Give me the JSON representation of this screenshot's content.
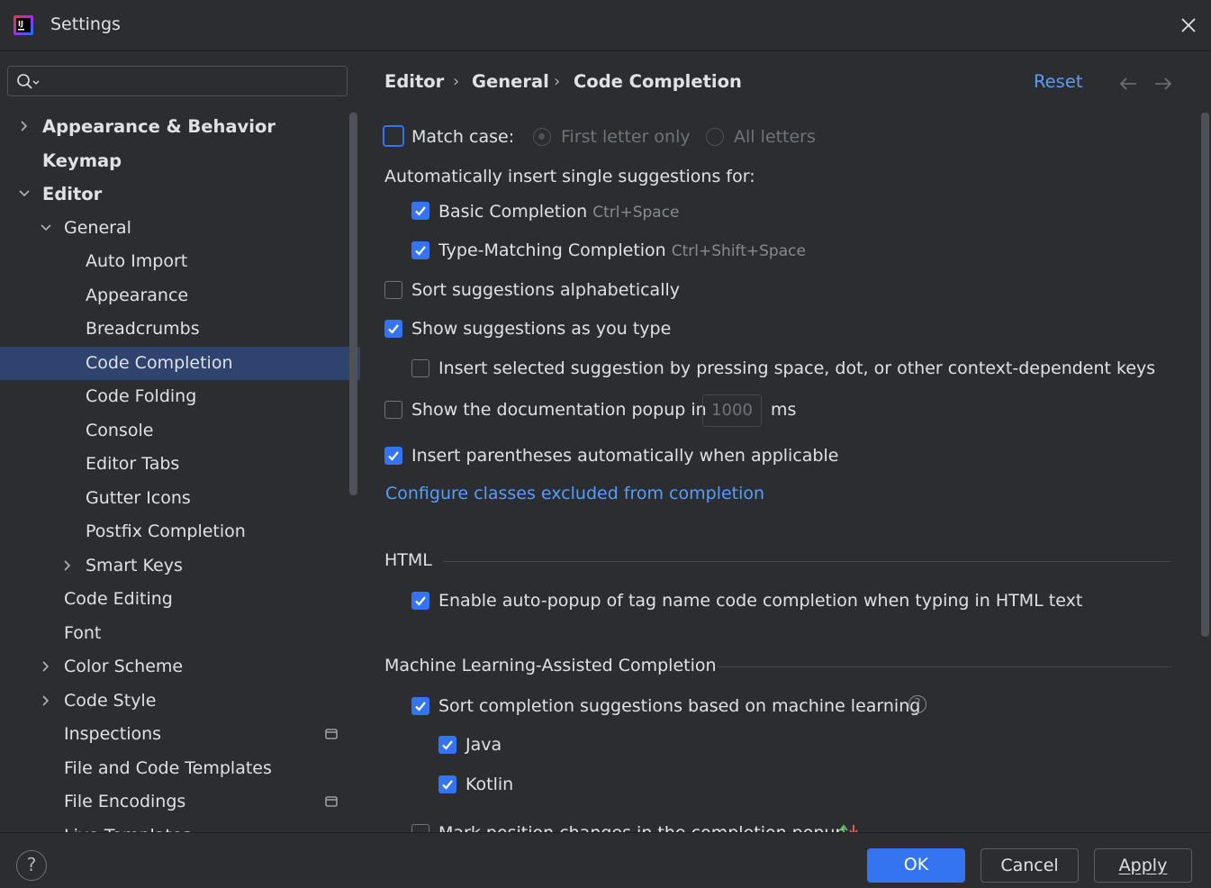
{
  "window": {
    "title": "Settings"
  },
  "search": {
    "placeholder": "",
    "value": ""
  },
  "tree": [
    {
      "label": "Appearance & Behavior",
      "level": 0,
      "bold": true,
      "arrow": "right"
    },
    {
      "label": "Keymap",
      "level": 0,
      "bold": true,
      "arrow": ""
    },
    {
      "label": "Editor",
      "level": 0,
      "bold": true,
      "arrow": "down"
    },
    {
      "label": "General",
      "level": 1,
      "bold": false,
      "arrow": "down"
    },
    {
      "label": "Auto Import",
      "level": 2,
      "bold": false,
      "arrow": ""
    },
    {
      "label": "Appearance",
      "level": 2,
      "bold": false,
      "arrow": ""
    },
    {
      "label": "Breadcrumbs",
      "level": 2,
      "bold": false,
      "arrow": ""
    },
    {
      "label": "Code Completion",
      "level": 2,
      "bold": false,
      "arrow": "",
      "selected": true
    },
    {
      "label": "Code Folding",
      "level": 2,
      "bold": false,
      "arrow": ""
    },
    {
      "label": "Console",
      "level": 2,
      "bold": false,
      "arrow": ""
    },
    {
      "label": "Editor Tabs",
      "level": 2,
      "bold": false,
      "arrow": ""
    },
    {
      "label": "Gutter Icons",
      "level": 2,
      "bold": false,
      "arrow": ""
    },
    {
      "label": "Postfix Completion",
      "level": 2,
      "bold": false,
      "arrow": ""
    },
    {
      "label": "Smart Keys",
      "level": 2,
      "bold": false,
      "arrow": "right"
    },
    {
      "label": "Code Editing",
      "level": 1,
      "bold": false,
      "arrow": ""
    },
    {
      "label": "Font",
      "level": 1,
      "bold": false,
      "arrow": ""
    },
    {
      "label": "Color Scheme",
      "level": 1,
      "bold": false,
      "arrow": "right"
    },
    {
      "label": "Code Style",
      "level": 1,
      "bold": false,
      "arrow": "right"
    },
    {
      "label": "Inspections",
      "level": 1,
      "bold": false,
      "arrow": "",
      "badge": "window-icon"
    },
    {
      "label": "File and Code Templates",
      "level": 1,
      "bold": false,
      "arrow": ""
    },
    {
      "label": "File Encodings",
      "level": 1,
      "bold": false,
      "arrow": "",
      "badge": "window-icon"
    },
    {
      "label": "Live Templates",
      "level": 1,
      "bold": false,
      "arrow": ""
    }
  ],
  "breadcrumb": [
    "Editor",
    "General",
    "Code Completion"
  ],
  "header": {
    "reset_label": "Reset"
  },
  "options": {
    "match_case": {
      "label": "Match case:",
      "checked": false
    },
    "first_letter_only": {
      "label": "First letter only",
      "selected": true
    },
    "all_letters": {
      "label": "All letters",
      "selected": false
    },
    "auto_insert_heading": "Automatically insert single suggestions for:",
    "basic_completion": {
      "label": "Basic Completion",
      "shortcut": "Ctrl+Space",
      "checked": true
    },
    "type_matching": {
      "label": "Type-Matching Completion",
      "shortcut": "Ctrl+Shift+Space",
      "checked": true
    },
    "sort_alpha": {
      "label": "Sort suggestions alphabetically",
      "checked": false
    },
    "show_as_type": {
      "label": "Show suggestions as you type",
      "checked": true
    },
    "insert_selected": {
      "label": "Insert selected suggestion by pressing space, dot, or other context-dependent keys",
      "checked": false
    },
    "doc_popup": {
      "label": "Show the documentation popup in",
      "value": "1000",
      "unit": "ms",
      "checked": false
    },
    "insert_parens": {
      "label": "Insert parentheses automatically when applicable",
      "checked": true
    },
    "configure_link": "Configure classes excluded from completion"
  },
  "html_section": {
    "title": "HTML",
    "auto_popup": {
      "label": "Enable auto-popup of tag name code completion when typing in HTML text",
      "checked": true
    }
  },
  "ml_section": {
    "title": "Machine Learning-Assisted Completion",
    "sort_ml": {
      "label": "Sort completion suggestions based on machine learning",
      "checked": true,
      "help": "?"
    },
    "java": {
      "label": "Java",
      "checked": true
    },
    "kotlin": {
      "label": "Kotlin",
      "checked": true
    },
    "mark_position": {
      "label": "Mark position changes in the completion popup",
      "checked": false
    }
  },
  "footer": {
    "help": "?",
    "ok_label": "OK",
    "cancel_label": "Cancel",
    "apply_label": "Apply"
  },
  "colors": {
    "accent": "#3574f0",
    "link": "#589df6",
    "selected_bg": "#2e436e",
    "background": "#2b2d30"
  }
}
